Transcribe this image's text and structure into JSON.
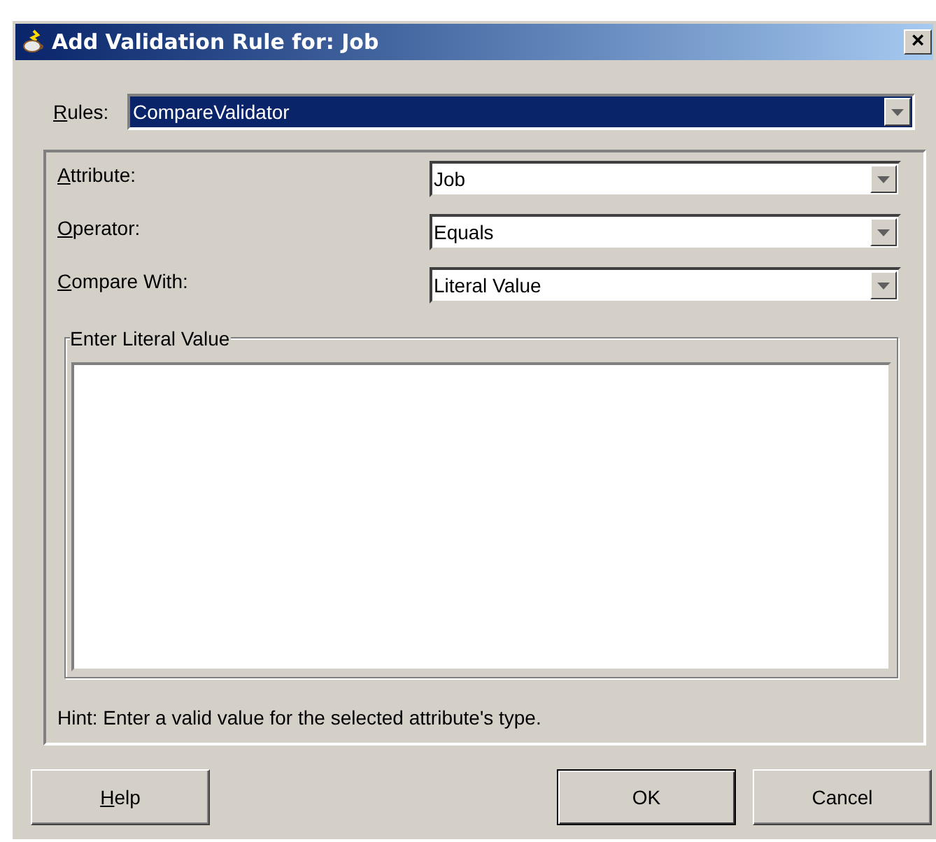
{
  "window": {
    "title": "Add Validation Rule for: Job",
    "close": "×"
  },
  "rules": {
    "label": "Rules:",
    "mnemonic": true,
    "value": "CompareValidator",
    "focused": true
  },
  "fields": [
    {
      "label": "Attribute:",
      "mnemonic": true,
      "value": "Job"
    },
    {
      "label": "Operator:",
      "mnemonic": true,
      "value": "Equals"
    },
    {
      "label": "Compare With:",
      "mnemonic": true,
      "value": "Literal Value"
    }
  ],
  "group": {
    "title": "Enter Literal Value"
  },
  "hint": "Hint: Enter a valid value for the selected attribute's type.",
  "buttons": [
    {
      "label": "Help",
      "mnemonic": true,
      "default": false
    },
    {
      "label": "OK",
      "default": true
    },
    {
      "label": "Cancel",
      "default": false
    }
  ]
}
